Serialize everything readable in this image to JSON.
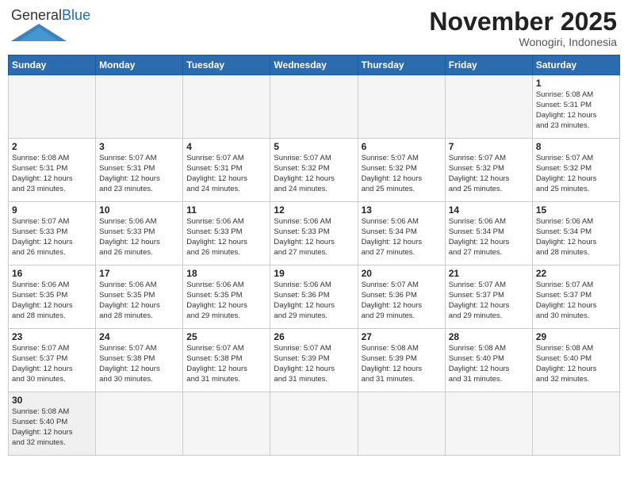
{
  "header": {
    "logo_general": "General",
    "logo_blue": "Blue",
    "month_title": "November 2025",
    "location": "Wonogiri, Indonesia"
  },
  "weekdays": [
    "Sunday",
    "Monday",
    "Tuesday",
    "Wednesday",
    "Thursday",
    "Friday",
    "Saturday"
  ],
  "days": [
    {
      "num": "",
      "info": "",
      "empty": true
    },
    {
      "num": "",
      "info": "",
      "empty": true
    },
    {
      "num": "",
      "info": "",
      "empty": true
    },
    {
      "num": "",
      "info": "",
      "empty": true
    },
    {
      "num": "",
      "info": "",
      "empty": true
    },
    {
      "num": "",
      "info": "",
      "empty": true
    },
    {
      "num": "1",
      "info": "Sunrise: 5:08 AM\nSunset: 5:31 PM\nDaylight: 12 hours\nand 23 minutes.",
      "empty": false
    },
    {
      "num": "2",
      "info": "Sunrise: 5:08 AM\nSunset: 5:31 PM\nDaylight: 12 hours\nand 23 minutes.",
      "empty": false
    },
    {
      "num": "3",
      "info": "Sunrise: 5:07 AM\nSunset: 5:31 PM\nDaylight: 12 hours\nand 23 minutes.",
      "empty": false
    },
    {
      "num": "4",
      "info": "Sunrise: 5:07 AM\nSunset: 5:31 PM\nDaylight: 12 hours\nand 24 minutes.",
      "empty": false
    },
    {
      "num": "5",
      "info": "Sunrise: 5:07 AM\nSunset: 5:32 PM\nDaylight: 12 hours\nand 24 minutes.",
      "empty": false
    },
    {
      "num": "6",
      "info": "Sunrise: 5:07 AM\nSunset: 5:32 PM\nDaylight: 12 hours\nand 25 minutes.",
      "empty": false
    },
    {
      "num": "7",
      "info": "Sunrise: 5:07 AM\nSunset: 5:32 PM\nDaylight: 12 hours\nand 25 minutes.",
      "empty": false
    },
    {
      "num": "8",
      "info": "Sunrise: 5:07 AM\nSunset: 5:32 PM\nDaylight: 12 hours\nand 25 minutes.",
      "empty": false
    },
    {
      "num": "9",
      "info": "Sunrise: 5:07 AM\nSunset: 5:33 PM\nDaylight: 12 hours\nand 26 minutes.",
      "empty": false
    },
    {
      "num": "10",
      "info": "Sunrise: 5:06 AM\nSunset: 5:33 PM\nDaylight: 12 hours\nand 26 minutes.",
      "empty": false
    },
    {
      "num": "11",
      "info": "Sunrise: 5:06 AM\nSunset: 5:33 PM\nDaylight: 12 hours\nand 26 minutes.",
      "empty": false
    },
    {
      "num": "12",
      "info": "Sunrise: 5:06 AM\nSunset: 5:33 PM\nDaylight: 12 hours\nand 27 minutes.",
      "empty": false
    },
    {
      "num": "13",
      "info": "Sunrise: 5:06 AM\nSunset: 5:34 PM\nDaylight: 12 hours\nand 27 minutes.",
      "empty": false
    },
    {
      "num": "14",
      "info": "Sunrise: 5:06 AM\nSunset: 5:34 PM\nDaylight: 12 hours\nand 27 minutes.",
      "empty": false
    },
    {
      "num": "15",
      "info": "Sunrise: 5:06 AM\nSunset: 5:34 PM\nDaylight: 12 hours\nand 28 minutes.",
      "empty": false
    },
    {
      "num": "16",
      "info": "Sunrise: 5:06 AM\nSunset: 5:35 PM\nDaylight: 12 hours\nand 28 minutes.",
      "empty": false
    },
    {
      "num": "17",
      "info": "Sunrise: 5:06 AM\nSunset: 5:35 PM\nDaylight: 12 hours\nand 28 minutes.",
      "empty": false
    },
    {
      "num": "18",
      "info": "Sunrise: 5:06 AM\nSunset: 5:35 PM\nDaylight: 12 hours\nand 29 minutes.",
      "empty": false
    },
    {
      "num": "19",
      "info": "Sunrise: 5:06 AM\nSunset: 5:36 PM\nDaylight: 12 hours\nand 29 minutes.",
      "empty": false
    },
    {
      "num": "20",
      "info": "Sunrise: 5:07 AM\nSunset: 5:36 PM\nDaylight: 12 hours\nand 29 minutes.",
      "empty": false
    },
    {
      "num": "21",
      "info": "Sunrise: 5:07 AM\nSunset: 5:37 PM\nDaylight: 12 hours\nand 29 minutes.",
      "empty": false
    },
    {
      "num": "22",
      "info": "Sunrise: 5:07 AM\nSunset: 5:37 PM\nDaylight: 12 hours\nand 30 minutes.",
      "empty": false
    },
    {
      "num": "23",
      "info": "Sunrise: 5:07 AM\nSunset: 5:37 PM\nDaylight: 12 hours\nand 30 minutes.",
      "empty": false
    },
    {
      "num": "24",
      "info": "Sunrise: 5:07 AM\nSunset: 5:38 PM\nDaylight: 12 hours\nand 30 minutes.",
      "empty": false
    },
    {
      "num": "25",
      "info": "Sunrise: 5:07 AM\nSunset: 5:38 PM\nDaylight: 12 hours\nand 31 minutes.",
      "empty": false
    },
    {
      "num": "26",
      "info": "Sunrise: 5:07 AM\nSunset: 5:39 PM\nDaylight: 12 hours\nand 31 minutes.",
      "empty": false
    },
    {
      "num": "27",
      "info": "Sunrise: 5:08 AM\nSunset: 5:39 PM\nDaylight: 12 hours\nand 31 minutes.",
      "empty": false
    },
    {
      "num": "28",
      "info": "Sunrise: 5:08 AM\nSunset: 5:40 PM\nDaylight: 12 hours\nand 31 minutes.",
      "empty": false
    },
    {
      "num": "29",
      "info": "Sunrise: 5:08 AM\nSunset: 5:40 PM\nDaylight: 12 hours\nand 32 minutes.",
      "empty": false
    },
    {
      "num": "30",
      "info": "Sunrise: 5:08 AM\nSunset: 5:40 PM\nDaylight: 12 hours\nand 32 minutes.",
      "empty": false
    },
    {
      "num": "",
      "info": "",
      "empty": true
    },
    {
      "num": "",
      "info": "",
      "empty": true
    },
    {
      "num": "",
      "info": "",
      "empty": true
    },
    {
      "num": "",
      "info": "",
      "empty": true
    },
    {
      "num": "",
      "info": "",
      "empty": true
    },
    {
      "num": "",
      "info": "",
      "empty": true
    }
  ]
}
